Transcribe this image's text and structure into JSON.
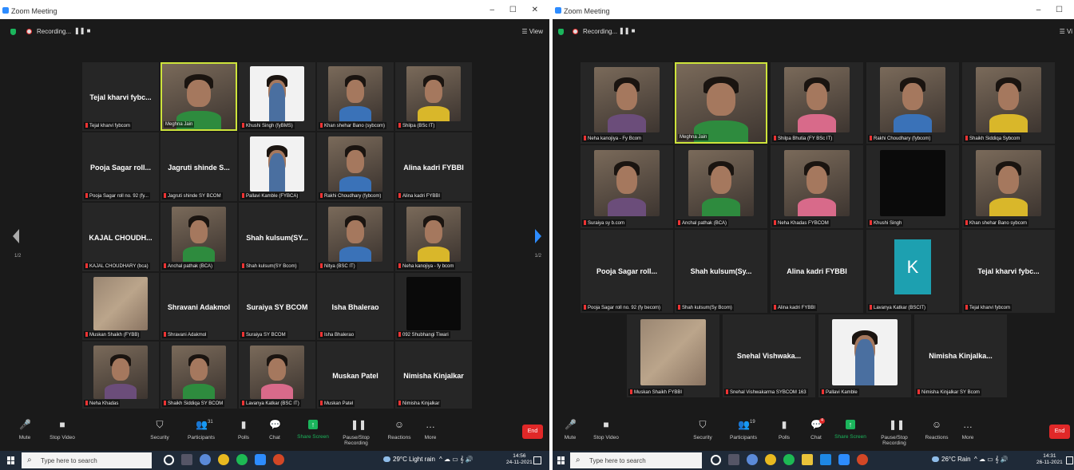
{
  "left": {
    "window_title": "Zoom Meeting",
    "window_controls": "– ☐ ✕",
    "recording_label": "Recording...",
    "recording_controls": "❚❚ ■",
    "view_label": "☰ View",
    "page_indicator_left": "1/2",
    "page_indicator_right": "1/2",
    "tiles": [
      {
        "big": "Tejal kharvi fybc...",
        "name": "Tejal kharvi fybcom",
        "video": false
      },
      {
        "big": "",
        "name": "Meghna Jain",
        "video": true,
        "active": true
      },
      {
        "big": "",
        "name": "Khushi Singh (fyBMS)",
        "video": true
      },
      {
        "big": "",
        "name": "Khan shehar Bano (sybcom)",
        "video": true
      },
      {
        "big": "",
        "name": "Shilpa (BSc IT)",
        "video": true
      },
      {
        "big": "Pooja Sagar roll...",
        "name": "Pooja Sagar roll no. 92 (fy...",
        "video": false
      },
      {
        "big": "Jagruti shinde S...",
        "name": "Jagruti shinde SY BCOM",
        "video": false
      },
      {
        "big": "",
        "name": "Pallavi Kamble (FYBCA)",
        "video": true
      },
      {
        "big": "",
        "name": "Rakhi Choudhary (fybcom)",
        "video": true
      },
      {
        "big": "Alina kadri FYBBI",
        "name": "Alina kadri FYBBI",
        "video": false
      },
      {
        "big": "KAJAL CHOUDH...",
        "name": "KAJAL CHOUDHARY (bca)",
        "video": false
      },
      {
        "big": "",
        "name": "Anchal pathak (BCA)",
        "video": true
      },
      {
        "big": "Shah kulsum(SY...",
        "name": "Shah kulsum(SY Bcom)",
        "video": false
      },
      {
        "big": "",
        "name": "Nitya (BSC IT)",
        "video": true
      },
      {
        "big": "",
        "name": "Neha kanojiya - fy bcom",
        "video": true
      },
      {
        "big": "",
        "name": "Muskan Shaikh (FYBB)",
        "video": true
      },
      {
        "big": "Shravani Adakmol",
        "name": "Shravani Adakmol",
        "video": false
      },
      {
        "big": "Suraiya SY BCOM",
        "name": "Suraiya SY BCOM",
        "video": false
      },
      {
        "big": "Isha Bhalerao",
        "name": "Isha Bhalerao",
        "video": false
      },
      {
        "big": "",
        "name": "092 Shubhangi Tiwari",
        "video": true
      },
      {
        "big": "",
        "name": "Neha Khadas",
        "video": true
      },
      {
        "big": "",
        "name": "Shaikh Siddiqa SY BCOM",
        "video": true
      },
      {
        "big": "",
        "name": "Lavanya Katkar (BSC IT)",
        "video": true
      },
      {
        "big": "Muskan Patel",
        "name": "Muskan Patel",
        "video": false
      },
      {
        "big": "Nimisha Kinjalkar",
        "name": "Nimisha Kinjalkar",
        "video": false
      }
    ],
    "toolbar": {
      "mute": "Mute",
      "stop_video": "Stop Video",
      "security": "Security",
      "participants": "Participants",
      "participants_count": "31",
      "polls": "Polls",
      "chat": "Chat",
      "share_screen": "Share Screen",
      "pause_recording": "Pause/Stop Recording",
      "reactions": "Reactions",
      "more": "More",
      "end": "End"
    },
    "taskbar": {
      "search_placeholder": "Type here to search",
      "weather": "29°C Light rain",
      "tray_icons": "^ ☁ ▭ 𝄞 🔊",
      "time": "14:56",
      "date": "24-11-2021"
    }
  },
  "right": {
    "window_title": "Zoom Meeting",
    "window_controls": "– ☐",
    "recording_label": "Recording...",
    "recording_controls": "❚❚ ■",
    "view_label": "☰ Vi",
    "tiles": [
      {
        "big": "",
        "name": "Neha kanojiya - Fy Bcom",
        "video": true
      },
      {
        "big": "",
        "name": "Meghna Jain",
        "video": true,
        "active": true
      },
      {
        "big": "",
        "name": "Shilpa Bhutia (FY BSc IT)",
        "video": true
      },
      {
        "big": "",
        "name": "Rakhi Choudhary (fybcom)",
        "video": true
      },
      {
        "big": "",
        "name": "Shaikh Siddiqa Sybcom",
        "video": true
      },
      {
        "big": "",
        "name": "Suraiya sy b.com",
        "video": true
      },
      {
        "big": "",
        "name": "Anchal pathak (BCA)",
        "video": true
      },
      {
        "big": "",
        "name": "Neha Khadas FYBCOM",
        "video": true
      },
      {
        "big": "",
        "name": "Khushi Singh",
        "video": true
      },
      {
        "big": "",
        "name": "Khan shehar Bano sybcom",
        "video": true
      },
      {
        "big": "Pooja Sagar roll...",
        "name": "Pooja Sagar roll no. 92 (fy becom)",
        "video": false
      },
      {
        "big": "Shah kulsum(Sy...",
        "name": "Shah kulsum(Sy Bcom)",
        "video": false
      },
      {
        "big": "Alina kadri FYBBI",
        "name": "Alina kadri FYBBI",
        "video": false
      },
      {
        "big": "K",
        "name": "Lavanya Katkar (BSCIT)",
        "video": false,
        "avatar": true
      },
      {
        "big": "Tejal kharvi fybc...",
        "name": "Tejal kharvi fybcom",
        "video": false
      },
      {
        "big": "",
        "name": "Muskan Shaikh FYBBI",
        "video": true
      },
      {
        "big": "Snehal Vishwaka...",
        "name": "Snehal Vishwakarma SYBCOM 163",
        "video": false
      },
      {
        "big": "",
        "name": "Pallavi Kamble",
        "video": true
      },
      {
        "big": "Nimisha Kinjalka...",
        "name": "Nimisha Kinjalkar SY Bcom",
        "video": false
      }
    ],
    "toolbar": {
      "mute": "Mute",
      "stop_video": "Stop Video",
      "security": "Security",
      "participants": "Participants",
      "participants_count": "19",
      "polls": "Polls",
      "chat": "Chat",
      "chat_badge": "4",
      "share_screen": "Share Screen",
      "pause_recording": "Pause/Stop Recording",
      "reactions": "Reactions",
      "more": "More",
      "end": "End"
    },
    "taskbar": {
      "search_placeholder": "Type here to search",
      "weather": "26°C Rain",
      "tray_icons": "^ ☁ ▭ 𝄞 🔊",
      "time": "14:31",
      "date": "26-11-2021"
    }
  }
}
